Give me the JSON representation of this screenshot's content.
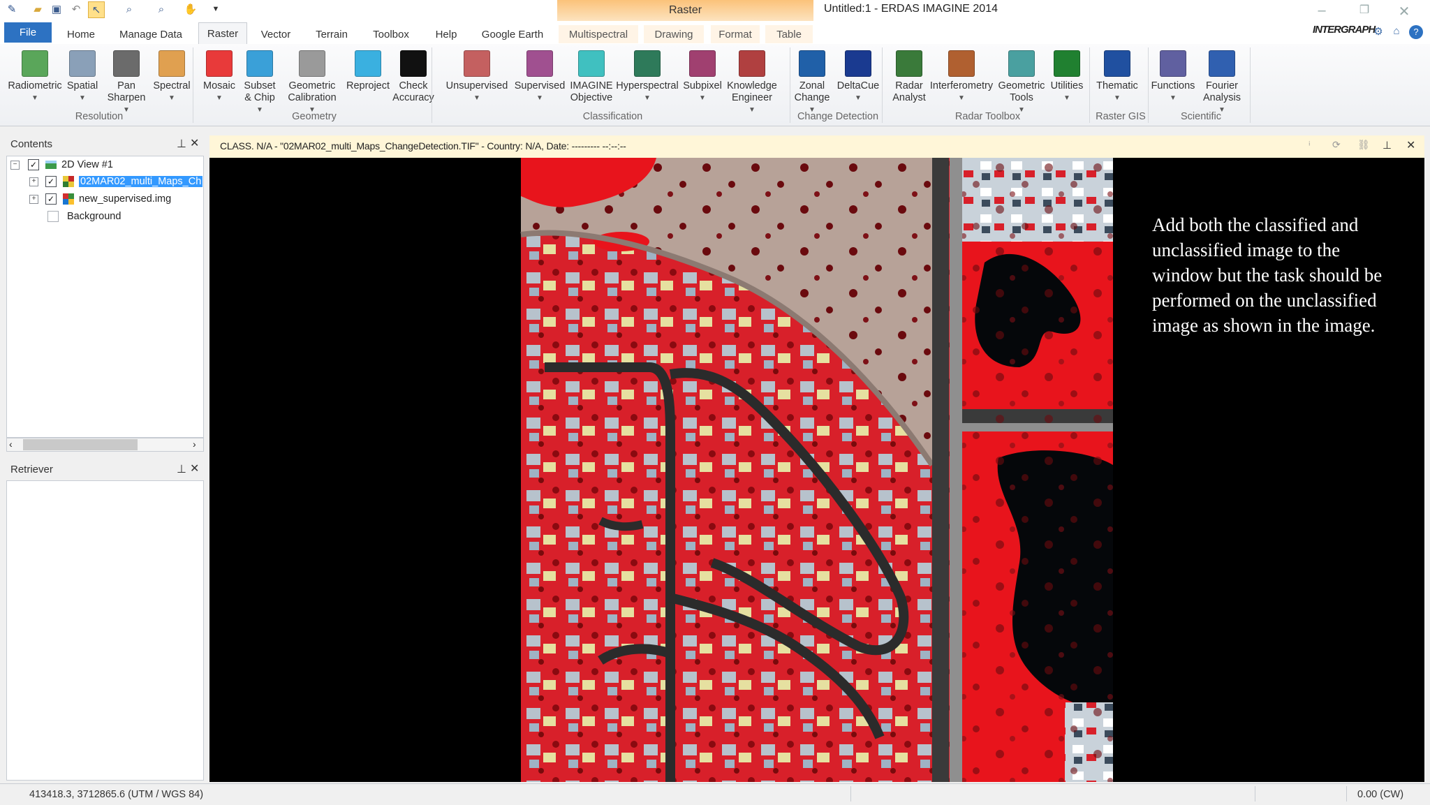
{
  "app": {
    "title": "Untitled:1 - ERDAS IMAGINE 2014",
    "context_tab": "Raster",
    "brand": "INTERGRAPH"
  },
  "quick_access": [
    "app-icon",
    "open-icon",
    "save-icon",
    "undo-icon",
    "select-icon",
    "zoom-in-icon",
    "zoom-out-icon",
    "pan-icon",
    "customize-icon"
  ],
  "tabs": [
    {
      "label": "File"
    },
    {
      "label": "Home"
    },
    {
      "label": "Manage Data"
    },
    {
      "label": "Raster"
    },
    {
      "label": "Vector"
    },
    {
      "label": "Terrain"
    },
    {
      "label": "Toolbox"
    },
    {
      "label": "Help"
    },
    {
      "label": "Google Earth"
    },
    {
      "label": "Multispectral"
    },
    {
      "label": "Drawing"
    },
    {
      "label": "Format"
    },
    {
      "label": "Table"
    }
  ],
  "ribbon": {
    "buttons": [
      {
        "l1": "Radiometric",
        "l2": "",
        "icon": "radiometric-icon",
        "color": "#5aa65a",
        "dd": true
      },
      {
        "l1": "Spatial",
        "l2": "",
        "icon": "spatial-icon",
        "color": "#8aa0b8",
        "dd": true
      },
      {
        "l1": "Pan",
        "l2": "Sharpen",
        "icon": "pan-sharpen-icon",
        "color": "#6b6b6b",
        "dd": true
      },
      {
        "l1": "Spectral",
        "l2": "",
        "icon": "spectral-icon",
        "color": "#e0a050",
        "dd": true
      },
      {
        "l1": "Mosaic",
        "l2": "",
        "icon": "mosaic-icon",
        "color": "#e83a3a",
        "dd": true
      },
      {
        "l1": "Subset",
        "l2": "& Chip",
        "icon": "subset-chip-icon",
        "color": "#3aa0d8",
        "dd": true
      },
      {
        "l1": "Geometric",
        "l2": "Calibration",
        "icon": "geometric-calibration-icon",
        "color": "#9a9a9a",
        "dd": true
      },
      {
        "l1": "Reproject",
        "l2": "",
        "icon": "reproject-icon",
        "color": "#3ab0e0",
        "dd": false
      },
      {
        "l1": "Check",
        "l2": "Accuracy",
        "icon": "check-accuracy-icon",
        "color": "#111111",
        "dd": false
      },
      {
        "l1": "Unsupervised",
        "l2": "",
        "icon": "unsupervised-icon",
        "color": "#c46060",
        "dd": true
      },
      {
        "l1": "Supervised",
        "l2": "",
        "icon": "supervised-icon",
        "color": "#a05090",
        "dd": true
      },
      {
        "l1": "IMAGINE",
        "l2": "Objective",
        "icon": "imagine-objective-icon",
        "color": "#40c0c0",
        "dd": false
      },
      {
        "l1": "Hyperspectral",
        "l2": "",
        "icon": "hyperspectral-icon",
        "color": "#2e7a5a",
        "dd": true
      },
      {
        "l1": "Subpixel",
        "l2": "",
        "icon": "subpixel-icon",
        "color": "#a04070",
        "dd": true
      },
      {
        "l1": "Knowledge",
        "l2": "Engineer",
        "icon": "knowledge-engineer-icon",
        "color": "#b04040",
        "dd": true
      },
      {
        "l1": "Zonal",
        "l2": "Change",
        "icon": "zonal-change-icon",
        "color": "#2060a8",
        "dd": true
      },
      {
        "l1": "DeltaCue",
        "l2": "",
        "icon": "deltacue-icon",
        "color": "#1a3a90",
        "dd": true
      },
      {
        "l1": "Radar",
        "l2": "Analyst",
        "icon": "radar-analyst-icon",
        "color": "#3a7a3a",
        "dd": false
      },
      {
        "l1": "Interferometry",
        "l2": "",
        "icon": "interferometry-icon",
        "color": "#b06030",
        "dd": true
      },
      {
        "l1": "Geometric",
        "l2": "Tools",
        "icon": "geometric-tools-icon",
        "color": "#4aa0a0",
        "dd": true
      },
      {
        "l1": "Utilities",
        "l2": "",
        "icon": "utilities-icon",
        "color": "#208030",
        "dd": true
      },
      {
        "l1": "Thematic",
        "l2": "",
        "icon": "thematic-icon",
        "color": "#2050a0",
        "dd": true
      },
      {
        "l1": "Functions",
        "l2": "",
        "icon": "functions-icon",
        "color": "#6060a0",
        "dd": true
      },
      {
        "l1": "Fourier",
        "l2": "Analysis",
        "icon": "fourier-analysis-icon",
        "color": "#3060b0",
        "dd": true
      }
    ],
    "groups": [
      "Resolution",
      "Geometry",
      "Classification",
      "Change Detection",
      "Radar Toolbox",
      "Raster GIS",
      "Scientific"
    ]
  },
  "contents": {
    "title": "Contents",
    "items": [
      {
        "label": "2D View #1"
      },
      {
        "label": "02MAR02_multi_Maps_Ch"
      },
      {
        "label": "new_supervised.img"
      },
      {
        "label": "Background"
      }
    ]
  },
  "retriever": {
    "title": "Retriever"
  },
  "viewer": {
    "title": "CLASS. N/A - \"02MAR02_multi_Maps_ChangeDetection.TIF\" - Country: N/A, Date: --------- --:--:--",
    "instruction": "Add both the classified and unclassified image to the window but the task should be performed on the unclassified image as shown in the image."
  },
  "status": {
    "coords": "413418.3, 3712865.6  (UTM / WGS 84)",
    "rotation": "0.00 (CW)"
  },
  "colors": {
    "file_tab": "#2d72c2",
    "context_tab": "#fbc27a",
    "viewer_header": "#fff6d8",
    "vegetation_red": "#e8141c",
    "selection": "#3399ff"
  }
}
